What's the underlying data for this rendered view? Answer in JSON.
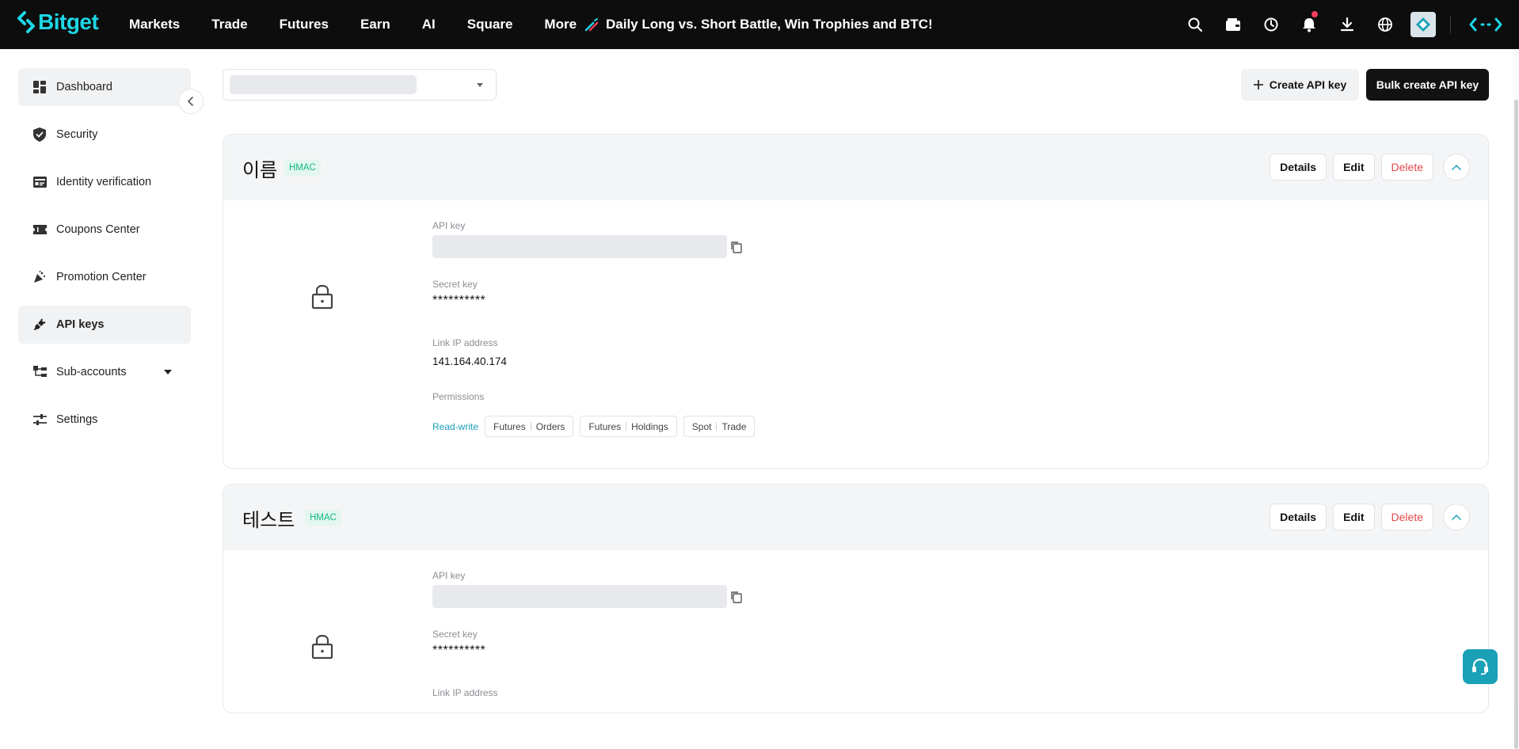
{
  "brand": {
    "name": "Bitget",
    "accent": "#1ed6e6"
  },
  "nav": {
    "items": [
      "Markets",
      "Trade",
      "Futures",
      "Earn",
      "AI",
      "Square",
      "More"
    ],
    "promo": "Daily Long vs. Short Battle, Win Trophies and BTC!"
  },
  "sidebar": {
    "items": [
      {
        "label": "Dashboard",
        "icon": "dashboard-icon"
      },
      {
        "label": "Security",
        "icon": "shield-icon"
      },
      {
        "label": "Identity verification",
        "icon": "id-card-icon"
      },
      {
        "label": "Coupons Center",
        "icon": "ticket-icon"
      },
      {
        "label": "Promotion Center",
        "icon": "party-popper-icon"
      },
      {
        "label": "API keys",
        "icon": "plug-icon"
      },
      {
        "label": "Sub-accounts",
        "icon": "sub-accounts-icon"
      },
      {
        "label": "Settings",
        "icon": "sliders-icon"
      }
    ]
  },
  "toolbar": {
    "create_label": "Create API key",
    "bulk_label": "Bulk create API key"
  },
  "cards": [
    {
      "name": "이름",
      "badge": "HMAC",
      "actions": {
        "details": "Details",
        "edit": "Edit",
        "delete": "Delete"
      },
      "api_key_label": "API key",
      "secret_key_label": "Secret key",
      "secret_key_value": "**********",
      "ip_label": "Link IP address",
      "ip_value": "141.164.40.174",
      "permissions_label": "Permissions",
      "permission_mode": "Read-write",
      "permissions": [
        {
          "a": "Futures",
          "b": "Orders"
        },
        {
          "a": "Futures",
          "b": "Holdings"
        },
        {
          "a": "Spot",
          "b": "Trade"
        }
      ]
    },
    {
      "name": "테스트",
      "badge": "HMAC",
      "actions": {
        "details": "Details",
        "edit": "Edit",
        "delete": "Delete"
      },
      "api_key_label": "API key",
      "secret_key_label": "Secret key",
      "secret_key_value": "**********",
      "ip_label": "Link IP address"
    }
  ]
}
